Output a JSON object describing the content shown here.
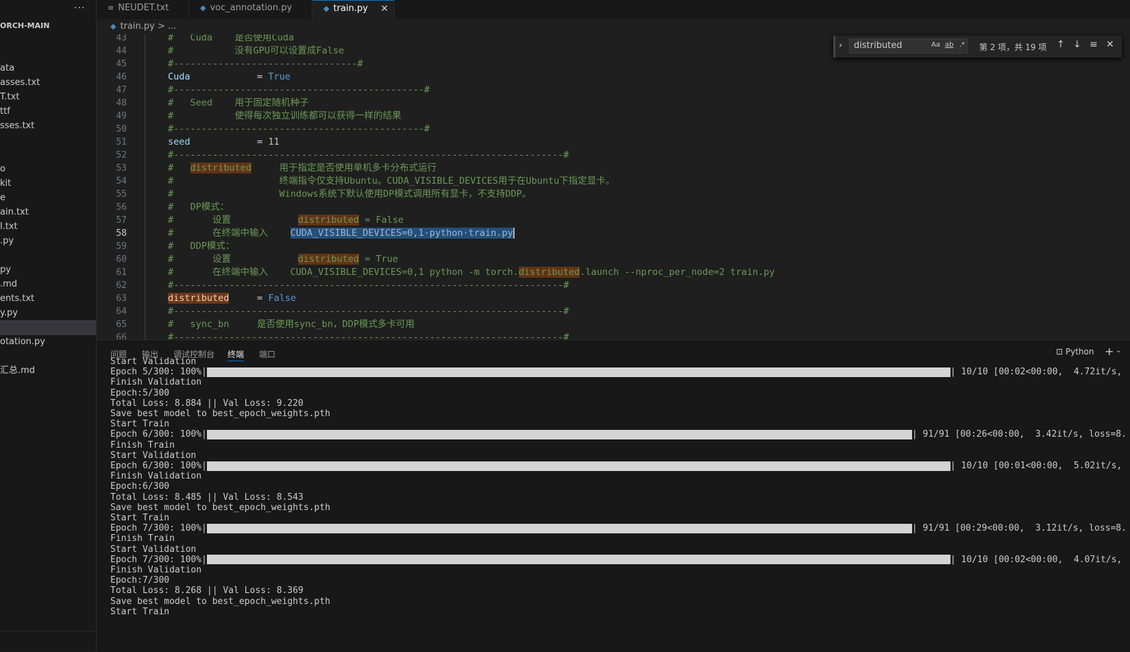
{
  "sidebar": {
    "more_label": "···",
    "project": "ORCH-MAIN",
    "files": [
      "ata",
      "asses.txt",
      "T.txt",
      "ttf",
      "sses.txt",
      "o",
      "kit",
      "e",
      "ain.txt",
      "l.txt",
      ".py",
      "py",
      ".md",
      "ents.txt",
      "y.py",
      "",
      "otation.py",
      "汇总.md"
    ],
    "selected_index": 15
  },
  "tabs": [
    {
      "label": "NEUDET.txt",
      "icon": "text-file-icon"
    },
    {
      "label": "voc_annotation.py",
      "icon": "python-icon"
    },
    {
      "label": "train.py",
      "icon": "python-icon",
      "active": true
    }
  ],
  "tab_close": "✕",
  "breadcrumb": {
    "file": "train.py",
    "sep": ">",
    "more": "..."
  },
  "find": {
    "query": "distributed",
    "opt_case": "Aa",
    "opt_word": "ab",
    "opt_regex": ".*",
    "result": "第 2 项，共 19 项"
  },
  "editor": {
    "lines": [
      {
        "n": "43",
        "parts": [
          [
            "c",
            "#   Cuda    是否使用Cuda"
          ]
        ]
      },
      {
        "n": "44",
        "parts": [
          [
            "c",
            "#           没有GPU可以设置成False"
          ]
        ]
      },
      {
        "n": "45",
        "parts": [
          [
            "c",
            "#---------------------------------#"
          ]
        ]
      },
      {
        "n": "46",
        "parts": [
          [
            "v",
            "Cuda"
          ],
          [
            "o",
            "            = "
          ],
          [
            "k",
            "True"
          ]
        ]
      },
      {
        "n": "47",
        "parts": [
          [
            "c",
            "#---------------------------------------------#"
          ]
        ]
      },
      {
        "n": "48",
        "parts": [
          [
            "c",
            "#   Seed    用于固定随机种子"
          ]
        ]
      },
      {
        "n": "49",
        "parts": [
          [
            "c",
            "#           使得每次独立训练都可以获得一样的结果"
          ]
        ]
      },
      {
        "n": "50",
        "parts": [
          [
            "c",
            "#---------------------------------------------#"
          ]
        ]
      },
      {
        "n": "51",
        "parts": [
          [
            "v",
            "seed"
          ],
          [
            "o",
            "            = "
          ],
          [
            "d",
            "11"
          ]
        ]
      },
      {
        "n": "52",
        "parts": [
          [
            "c",
            "#----------------------------------------------------------------------#"
          ]
        ]
      },
      {
        "n": "53",
        "parts": [
          [
            "c",
            "#   "
          ],
          [
            "h",
            "distributed"
          ],
          [
            "c",
            "     用于指定是否使用单机多卡分布式运行"
          ]
        ]
      },
      {
        "n": "54",
        "parts": [
          [
            "c",
            "#                   终端指令仅支持Ubuntu。CUDA_VISIBLE_DEVICES用于在Ubuntu下指定显卡。"
          ]
        ]
      },
      {
        "n": "55",
        "parts": [
          [
            "c",
            "#                   Windows系统下默认使用DP模式调用所有显卡，不支持DDP。"
          ]
        ]
      },
      {
        "n": "56",
        "parts": [
          [
            "c",
            "#   DP模式："
          ]
        ]
      },
      {
        "n": "57",
        "parts": [
          [
            "c",
            "#       设置            "
          ],
          [
            "h",
            "distributed"
          ],
          [
            "c",
            " = False"
          ]
        ]
      },
      {
        "n": "58",
        "parts": [
          [
            "c",
            "#       在终端中输入    "
          ],
          [
            "s",
            "CUDA_VISIBLE_DEVICES=0,1·python·train.py"
          ],
          [
            "x",
            ""
          ]
        ],
        "current": true
      },
      {
        "n": "59",
        "parts": [
          [
            "c",
            "#   DDP模式："
          ]
        ]
      },
      {
        "n": "60",
        "parts": [
          [
            "c",
            "#       设置            "
          ],
          [
            "h",
            "distributed"
          ],
          [
            "c",
            " = True"
          ]
        ]
      },
      {
        "n": "61",
        "parts": [
          [
            "c",
            "#       在终端中输入    CUDA_VISIBLE_DEVICES=0,1 python -m torch."
          ],
          [
            "h",
            "distributed"
          ],
          [
            "c",
            ".launch --nproc_per_node=2 train.py"
          ]
        ]
      },
      {
        "n": "62",
        "parts": [
          [
            "c",
            "#----------------------------------------------------------------------#"
          ]
        ]
      },
      {
        "n": "63",
        "parts": [
          [
            "hv",
            "distributed"
          ],
          [
            "o",
            "     = "
          ],
          [
            "k",
            "False"
          ]
        ]
      },
      {
        "n": "64",
        "parts": [
          [
            "c",
            "#----------------------------------------------------------------------#"
          ]
        ]
      },
      {
        "n": "65",
        "parts": [
          [
            "c",
            "#   sync_bn     是否使用sync_bn，DDP模式多卡可用"
          ]
        ]
      },
      {
        "n": "66",
        "parts": [
          [
            "c",
            "#----------------------------------------------------------------------#"
          ]
        ]
      }
    ]
  },
  "panel": {
    "tabs": [
      "问题",
      "输出",
      "调试控制台",
      "终端",
      "端口"
    ],
    "active_tab": 3,
    "terminal_name": "Python",
    "new_label": "+",
    "caret": "⌄"
  },
  "terminal": [
    {
      "t": "Start Validation"
    },
    {
      "pre": "Epoch 5/300: 100%|",
      "fill": 1.0,
      "width": 1085,
      "post": "| 10/10 [00:02<00:00,  4.72it/s,"
    },
    {
      "t": "Finish Validation"
    },
    {
      "t": "Epoch:5/300"
    },
    {
      "t": "Total Loss: 8.884 || Val Loss: 9.220"
    },
    {
      "t": "Save best model to best_epoch_weights.pth"
    },
    {
      "t": "Start Train"
    },
    {
      "pre": "Epoch 6/300: 100%|",
      "fill": 1.0,
      "width": 1029,
      "post": "| 91/91 [00:26<00:00,  3.42it/s, loss=8."
    },
    {
      "t": "Finish Train"
    },
    {
      "t": "Start Validation"
    },
    {
      "pre": "Epoch 6/300: 100%|",
      "fill": 1.0,
      "width": 1085,
      "post": "| 10/10 [00:01<00:00,  5.02it/s,"
    },
    {
      "t": "Finish Validation"
    },
    {
      "t": "Epoch:6/300"
    },
    {
      "t": "Total Loss: 8.485 || Val Loss: 8.543"
    },
    {
      "t": "Save best model to best_epoch_weights.pth"
    },
    {
      "t": "Start Train"
    },
    {
      "pre": "Epoch 7/300: 100%|",
      "fill": 1.0,
      "width": 1029,
      "post": "| 91/91 [00:29<00:00,  3.12it/s, loss=8."
    },
    {
      "t": "Finish Train"
    },
    {
      "t": "Start Validation"
    },
    {
      "pre": "Epoch 7/300: 100%|",
      "fill": 1.0,
      "width": 1085,
      "post": "| 10/10 [00:02<00:00,  4.07it/s,"
    },
    {
      "t": "Finish Validation"
    },
    {
      "t": "Epoch:7/300"
    },
    {
      "t": "Total Loss: 8.268 || Val Loss: 8.369"
    },
    {
      "t": "Save best model to best_epoch_weights.pth"
    },
    {
      "t": "Start Train"
    }
  ]
}
